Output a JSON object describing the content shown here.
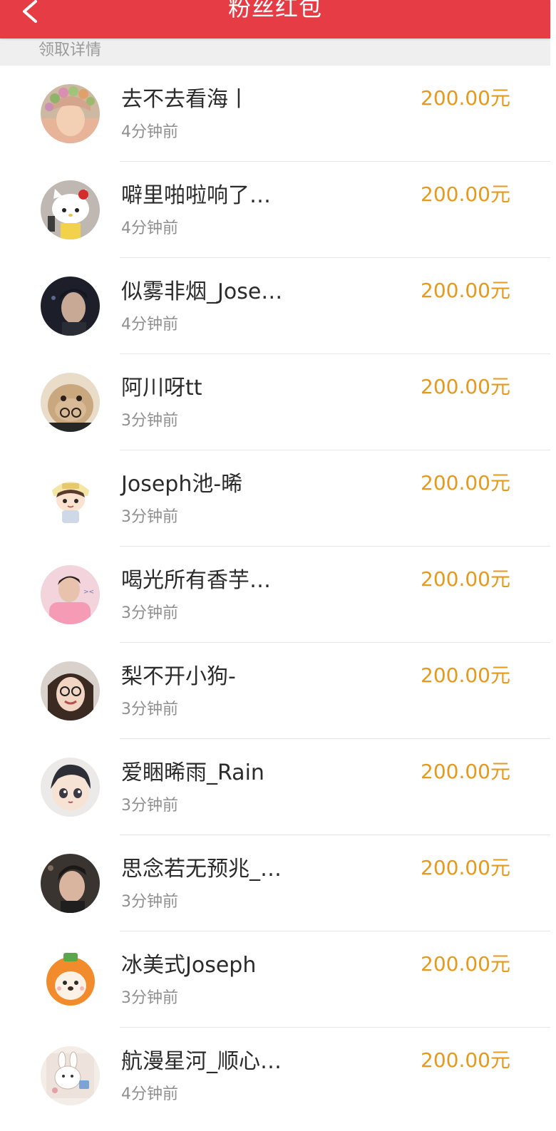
{
  "header": {
    "title": "粉丝红包",
    "back_icon": "chevron-left-icon",
    "bg_color": "#e63c46"
  },
  "section": {
    "label": "领取详情"
  },
  "colors": {
    "amount": "#e59a1d",
    "name": "#2b2b2b",
    "time": "#8f8f8f"
  },
  "rows": [
    {
      "name": "去不去看海丨",
      "time": "4分钟前",
      "amount": "200.00元",
      "avatar_icon": "avatar-flower-crown"
    },
    {
      "name": "噼里啪啦响了…",
      "time": "4分钟前",
      "amount": "200.00元",
      "avatar_icon": "avatar-hello-kitty"
    },
    {
      "name": "似雾非烟_Jose…",
      "time": "4分钟前",
      "amount": "200.00元",
      "avatar_icon": "avatar-dark-portrait"
    },
    {
      "name": "阿川呀tt",
      "time": "3分钟前",
      "amount": "200.00元",
      "avatar_icon": "avatar-plush-bear"
    },
    {
      "name": "Joseph池-晞",
      "time": "3分钟前",
      "amount": "200.00元",
      "avatar_icon": "avatar-cartoon-boy"
    },
    {
      "name": "喝光所有香芋…",
      "time": "3分钟前",
      "amount": "200.00元",
      "avatar_icon": "avatar-pink-portrait"
    },
    {
      "name": "梨不开小狗-",
      "time": "3分钟前",
      "amount": "200.00元",
      "avatar_icon": "avatar-girl-glasses"
    },
    {
      "name": "爱睏晞雨_Rain",
      "time": "3分钟前",
      "amount": "200.00元",
      "avatar_icon": "avatar-anime-boy"
    },
    {
      "name": "思念若无预兆_…",
      "time": "3分钟前",
      "amount": "200.00元",
      "avatar_icon": "avatar-selfie"
    },
    {
      "name": "冰美式Joseph",
      "time": "3分钟前",
      "amount": "200.00元",
      "avatar_icon": "avatar-orange-pet"
    },
    {
      "name": "航漫星河_顺心…",
      "time": "4分钟前",
      "amount": "200.00元",
      "avatar_icon": "avatar-bunny-sticker"
    }
  ]
}
